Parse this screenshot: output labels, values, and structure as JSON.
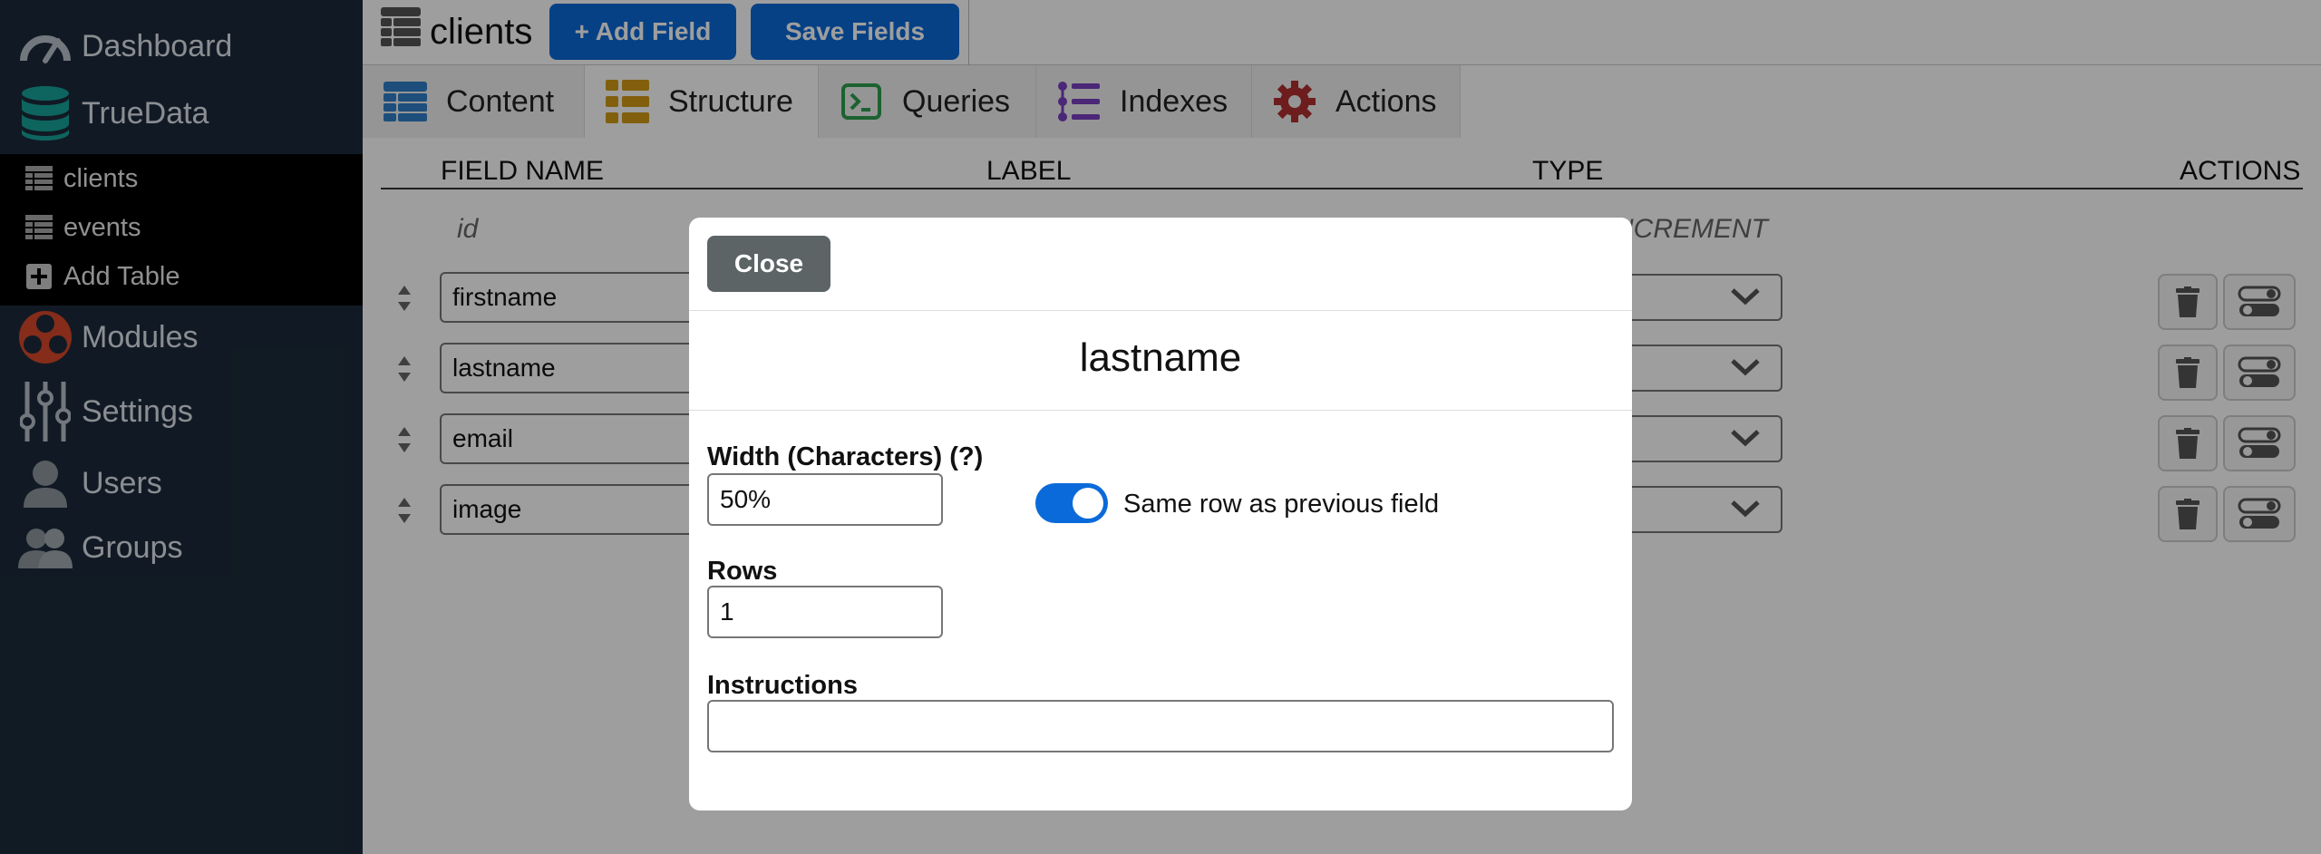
{
  "sidebar": {
    "items": [
      {
        "label": "Dashboard",
        "icon": "gauge-icon"
      },
      {
        "label": "TrueData",
        "icon": "database-icon"
      },
      {
        "label": "Modules",
        "icon": "modules-icon"
      },
      {
        "label": "Settings",
        "icon": "sliders-icon"
      },
      {
        "label": "Users",
        "icon": "user-icon"
      },
      {
        "label": "Groups",
        "icon": "users-icon"
      }
    ],
    "sub_items": [
      {
        "label": "clients",
        "icon": "table-icon"
      },
      {
        "label": "events",
        "icon": "table-icon"
      },
      {
        "label": "Add Table",
        "icon": "plus-square-icon"
      }
    ]
  },
  "header": {
    "table_name": "clients",
    "add_field_label": "+ Add Field",
    "save_fields_label": "Save Fields"
  },
  "tabs": [
    {
      "label": "Content",
      "icon": "table-icon",
      "color": "#2f7fc8"
    },
    {
      "label": "Structure",
      "icon": "list-icon",
      "color": "#d09a15"
    },
    {
      "label": "Queries",
      "icon": "terminal-icon",
      "color": "#2e9e4f"
    },
    {
      "label": "Indexes",
      "icon": "list-ordered-icon",
      "color": "#7a3fc0"
    },
    {
      "label": "Actions",
      "icon": "gear-icon",
      "color": "#b03030"
    }
  ],
  "columns": {
    "field_name": "FIELD NAME",
    "label": "LABEL",
    "type": "TYPE",
    "actions": "ACTIONS"
  },
  "id_row": {
    "name": "id",
    "type": "NCREMENT"
  },
  "fields": [
    {
      "name": "firstname"
    },
    {
      "name": "lastname"
    },
    {
      "name": "email"
    },
    {
      "name": "image"
    }
  ],
  "modal": {
    "close_label": "Close",
    "title": "lastname",
    "width_label": "Width (Characters) (?)",
    "width_value": "50%",
    "same_row_label": "Same row as previous field",
    "same_row_on": true,
    "rows_label": "Rows",
    "rows_value": "1",
    "instructions_label": "Instructions",
    "instructions_value": ""
  },
  "colors": {
    "sidebar_bg": "#1c2b3a",
    "primary": "#0b6ad9",
    "close_btn": "#5c6466"
  }
}
